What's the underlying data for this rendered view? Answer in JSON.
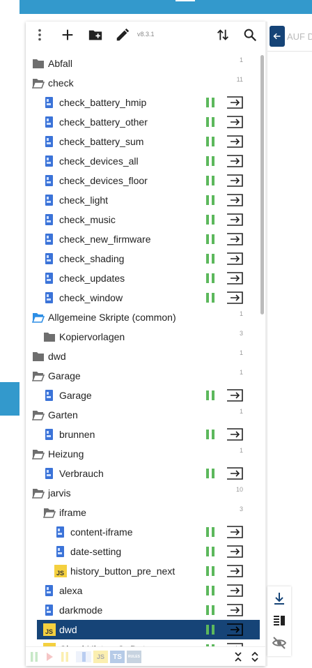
{
  "toolbar": {
    "version": "v8.3.1",
    "icons": [
      "more-vert-icon",
      "add-icon",
      "add-folder-icon",
      "edit-icon",
      "sort-icon",
      "search-icon"
    ]
  },
  "right_panel": {
    "back_label": "AUF D"
  },
  "colors": {
    "accent": "#3399cc",
    "selected": "#164477",
    "pause": "#5cb85c",
    "folder": "#6e6e6e",
    "folder_open_blue": "#2d8ee5",
    "blockly": "#3b73d8",
    "js": "#f4d03f"
  },
  "tree": [
    {
      "label": "Abfall",
      "type": "folder",
      "indent": 0,
      "count": "1"
    },
    {
      "label": "check",
      "type": "folder-open",
      "indent": 0,
      "count": "11"
    },
    {
      "label": "check_battery_hmip",
      "type": "blockly",
      "indent": 1
    },
    {
      "label": "check_battery_other",
      "type": "blockly",
      "indent": 1
    },
    {
      "label": "check_battery_sum",
      "type": "blockly",
      "indent": 1
    },
    {
      "label": "check_devices_all",
      "type": "blockly",
      "indent": 1
    },
    {
      "label": "check_devices_floor",
      "type": "blockly",
      "indent": 1
    },
    {
      "label": "check_light",
      "type": "blockly",
      "indent": 1
    },
    {
      "label": "check_music",
      "type": "blockly",
      "indent": 1
    },
    {
      "label": "check_new_firmware",
      "type": "blockly",
      "indent": 1
    },
    {
      "label": "check_shading",
      "type": "blockly",
      "indent": 1
    },
    {
      "label": "check_updates",
      "type": "blockly",
      "indent": 1
    },
    {
      "label": "check_window",
      "type": "blockly",
      "indent": 1
    },
    {
      "label": "Allgemeine Skripte (common)",
      "type": "folder-open-blue",
      "indent": 0,
      "count": "1"
    },
    {
      "label": "Kopiervorlagen",
      "type": "folder",
      "indent": 1,
      "count": "3"
    },
    {
      "label": "dwd",
      "type": "folder",
      "indent": 0,
      "count": "1"
    },
    {
      "label": "Garage",
      "type": "folder-open",
      "indent": 0,
      "count": "1"
    },
    {
      "label": "Garage",
      "type": "blockly",
      "indent": 1
    },
    {
      "label": "Garten",
      "type": "folder-open",
      "indent": 0,
      "count": "1"
    },
    {
      "label": "brunnen",
      "type": "blockly",
      "indent": 1
    },
    {
      "label": "Heizung",
      "type": "folder-open",
      "indent": 0,
      "count": "1"
    },
    {
      "label": "Verbrauch",
      "type": "blockly",
      "indent": 1
    },
    {
      "label": "jarvis",
      "type": "folder-open",
      "indent": 0,
      "count": "10"
    },
    {
      "label": "iframe",
      "type": "folder-open",
      "indent": 1,
      "count": "3"
    },
    {
      "label": "content-iframe",
      "type": "blockly",
      "indent": 2
    },
    {
      "label": "date-setting",
      "type": "blockly",
      "indent": 2
    },
    {
      "label": "history_button_pre_next",
      "type": "js",
      "indent": 2
    },
    {
      "label": "alexa",
      "type": "blockly",
      "indent": 1
    },
    {
      "label": "darkmode",
      "type": "blockly",
      "indent": 1
    },
    {
      "label": "dwd",
      "type": "js",
      "indent": 1,
      "selected": true
    },
    {
      "label": "CheckHistoryOnDat...",
      "type": "js",
      "indent": 1
    }
  ],
  "bottom_bar": {
    "filters": [
      "pause-filter-icon",
      "play-filter-icon",
      "pause-filter-icon",
      "blockly-filter-icon",
      "js-filter-icon",
      "ts-filter-icon",
      "rules-filter-icon"
    ],
    "js_label": "JS",
    "ts_label": "TS",
    "rules_label": "RULES"
  }
}
